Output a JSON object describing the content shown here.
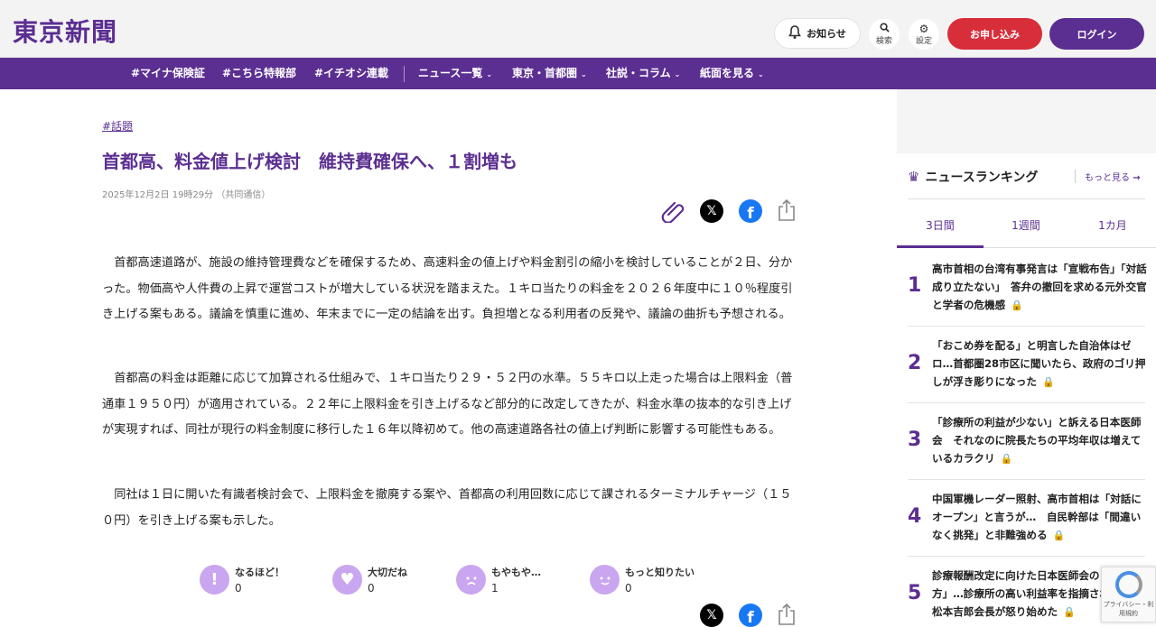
{
  "header": {
    "logo": "東京新聞",
    "notice_label": "お知らせ",
    "search_label": "検索",
    "settings_label": "設定",
    "apply_label": "お申し込み",
    "login_label": "ログイン"
  },
  "nav": {
    "items": [
      {
        "label": "#マイナ保険証"
      },
      {
        "label": "#こちら特報部"
      },
      {
        "label": "#イチオシ連載"
      },
      {
        "label": "ニュース一覧"
      },
      {
        "label": "東京・首都圏"
      },
      {
        "label": "社説・コラム"
      },
      {
        "label": "紙面を見る"
      }
    ]
  },
  "article": {
    "tag": "#話題",
    "title": "首都高、料金値上げ検討　維持費確保へ、１割増も",
    "date": "2025年12月2日 19時29分 （共同通信）",
    "paragraphs": [
      "首都高速道路が、施設の維持管理費などを確保するため、高速料金の値上げや料金割引の縮小を検討していることが２日、分かった。物価高や人件費の上昇で運営コストが増大している状況を踏まえた。１キロ当たりの料金を２０２６年度中に１０％程度引き上げる案もある。議論を慎重に進め、年末までに一定の結論を出す。負担増となる利用者の反発や、議論の曲折も予想される。",
      "首都高の料金は距離に応じて加算される仕組みで、１キロ当たり２９・５２円の水準。５５キロ以上走った場合は上限料金（普通車１９５０円）が適用されている。２２年に上限料金を引き上げるなど部分的に改定してきたが、料金水準の抜本的な引き上げが実現すれば、同社が現行の料金制度に移行した１６年以降初めて。他の高速道路各社の値上げ判断に影響する可能性もある。",
      "同社は１日に開いた有識者検討会で、上限料金を撤廃する案や、首都高の利用回数に応じて課されるターミナルチャージ（１５０円）を引き上げる案も示した。"
    ]
  },
  "reactions": [
    {
      "label": "なるほど！",
      "count": "0"
    },
    {
      "label": "大切だね",
      "count": "0"
    },
    {
      "label": "もやもや…",
      "count": "1"
    },
    {
      "label": "もっと知りたい",
      "count": "0"
    }
  ],
  "sidebar": {
    "ranking_title": "ニュースランキング",
    "more_label": "もっと見る",
    "tabs": [
      {
        "label": "3日間"
      },
      {
        "label": "1週間"
      },
      {
        "label": "1カ月"
      }
    ],
    "ranking": [
      {
        "num": "1",
        "title": "高市首相の台湾有事発言は「宣戦布告」「対話成り立たない」　答弁の撤回を求める元外交官と学者の危機感",
        "lock": "gold"
      },
      {
        "num": "2",
        "title": "「おこめ券を配る」と明言した自治体はゼロ…首都圏28市区に聞いたら、政府のゴリ押しが浮き彫りになった",
        "lock": "gold"
      },
      {
        "num": "3",
        "title": "「診療所の利益が少ない」と訴える日本医師会　それなのに院長たちの平均年収は増えているカラクリ",
        "lock": "gold"
      },
      {
        "num": "4",
        "title": "中国軍機レーダー照射、高市首相は「対話にオープン」と言うが…　自民幹部は「間違いなく挑発」と非難強める",
        "lock": "gray"
      },
      {
        "num": "5",
        "title": "診療報酬改定に向けた日本医師会の「考え方」…診療所の高い利益率を指摘されると、松本吉郎会長が怒り始めた",
        "lock": "gold"
      }
    ]
  },
  "recaptcha": {
    "label": "プライバシー・利用規約"
  },
  "colors": {
    "brand": "#5b2e91",
    "apply": "#d72e3a",
    "facebook": "#1877f2",
    "reaction": "#c9a6ef"
  }
}
